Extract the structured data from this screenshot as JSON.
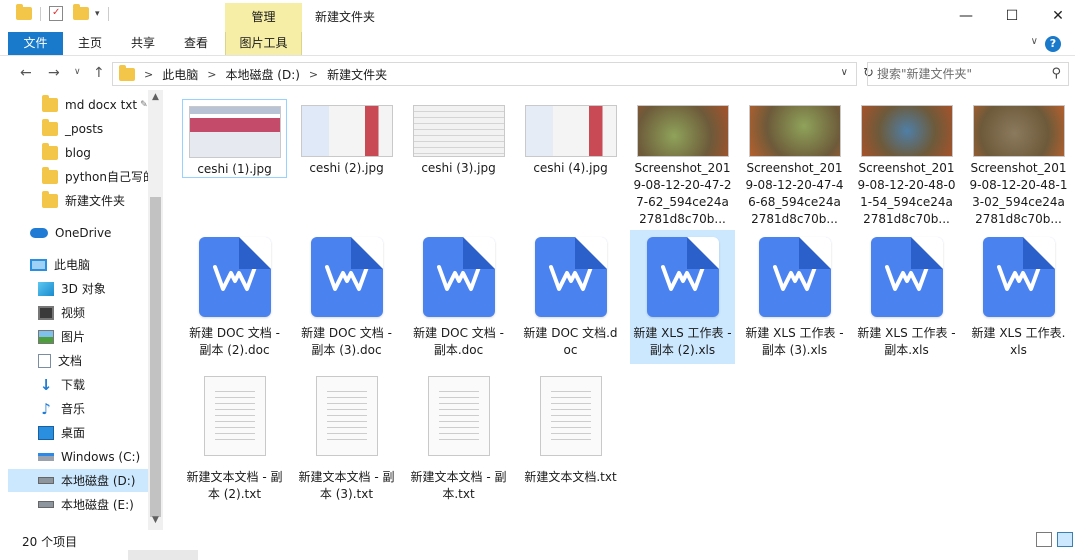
{
  "window": {
    "title": "新建文件夹",
    "manage_tab": "管理",
    "minimize": "—",
    "maximize": "☐",
    "close": "✕"
  },
  "ribbon": {
    "tabs": [
      "文件",
      "主页",
      "共享",
      "查看",
      "图片工具"
    ],
    "help": "?"
  },
  "address": {
    "path": [
      "此电脑",
      "本地磁盘 (D:)",
      "新建文件夹"
    ],
    "search_placeholder": "搜索\"新建文件夹\""
  },
  "sidebar": {
    "items": [
      {
        "label": "md docx txt",
        "icon": "folder-icon"
      },
      {
        "label": "_posts",
        "icon": "folder-icon"
      },
      {
        "label": "blog",
        "icon": "folder-icon"
      },
      {
        "label": "python自己写的",
        "icon": "folder-icon"
      },
      {
        "label": "新建文件夹",
        "icon": "folder-icon"
      },
      {
        "label": "OneDrive",
        "icon": "onedrive-icon"
      },
      {
        "label": "此电脑",
        "icon": "computer-icon"
      },
      {
        "label": "3D 对象",
        "icon": "3d-objects-icon"
      },
      {
        "label": "视频",
        "icon": "video-icon"
      },
      {
        "label": "图片",
        "icon": "pictures-icon"
      },
      {
        "label": "文档",
        "icon": "documents-icon"
      },
      {
        "label": "下载",
        "icon": "download-icon"
      },
      {
        "label": "音乐",
        "icon": "music-icon"
      },
      {
        "label": "桌面",
        "icon": "desktop-icon"
      },
      {
        "label": "Windows (C:)",
        "icon": "windows-drive-icon"
      },
      {
        "label": "本地磁盘 (D:)",
        "icon": "drive-icon"
      },
      {
        "label": "本地磁盘 (E:)",
        "icon": "drive-icon"
      }
    ]
  },
  "files": {
    "row1": [
      {
        "name": "ceshi (1).jpg",
        "kind": "web"
      },
      {
        "name": "ceshi (2).jpg",
        "kind": "web"
      },
      {
        "name": "ceshi (3).jpg",
        "kind": "web"
      },
      {
        "name": "ceshi (4).jpg",
        "kind": "web"
      },
      {
        "name": "Screenshot_2019-08-12-20-47-27-62_594ce24a2781d8c70b...",
        "kind": "game"
      },
      {
        "name": "Screenshot_2019-08-12-20-47-46-68_594ce24a2781d8c70b...",
        "kind": "game"
      },
      {
        "name": "Screenshot_2019-08-12-20-48-01-54_594ce24a2781d8c70b...",
        "kind": "game"
      },
      {
        "name": "Screenshot_2019-08-12-20-48-13-02_594ce24a2781d8c70b...",
        "kind": "game"
      }
    ],
    "row2": [
      {
        "name": "新建 DOC 文档 - 副本 (2).doc"
      },
      {
        "name": "新建 DOC 文档 - 副本 (3).doc"
      },
      {
        "name": "新建 DOC 文档 - 副本.doc"
      },
      {
        "name": "新建 DOC 文档.doc"
      },
      {
        "name": "新建 XLS 工作表 - 副本 (2).xls"
      },
      {
        "name": "新建 XLS 工作表 - 副本 (3).xls"
      },
      {
        "name": "新建 XLS 工作表 - 副本.xls"
      },
      {
        "name": "新建 XLS 工作表.xls"
      }
    ],
    "row3": [
      {
        "name": "新建文本文档 - 副本 (2).txt"
      },
      {
        "name": "新建文本文档 - 副本 (3).txt"
      },
      {
        "name": "新建文本文档 - 副本.txt"
      },
      {
        "name": "新建文本文档.txt"
      }
    ]
  },
  "status": {
    "count": "20 个项目"
  },
  "colors": {
    "accent": "#1979ca",
    "selection": "#cce8ff",
    "manage": "#f6eea6",
    "folder": "#f3c64a",
    "wps": "#4a82f0"
  }
}
